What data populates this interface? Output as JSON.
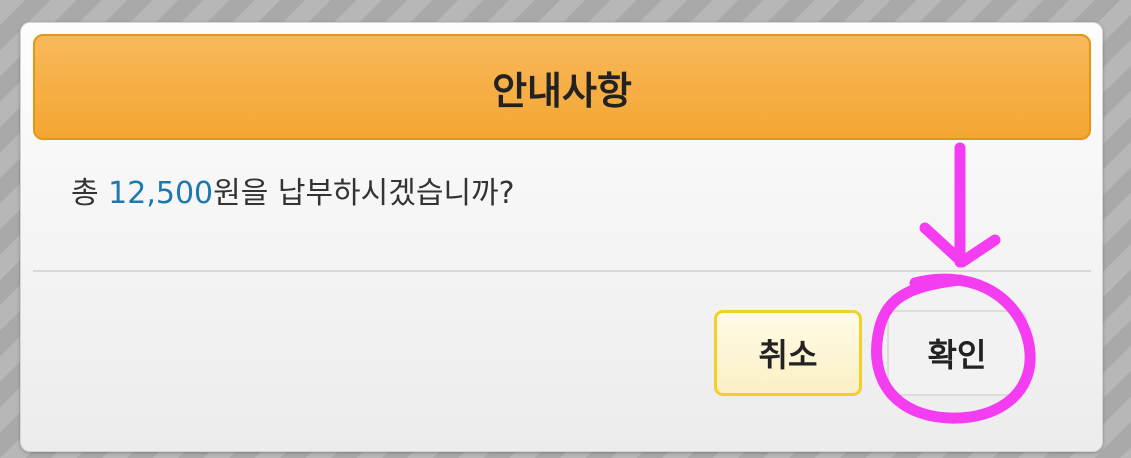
{
  "dialog": {
    "title": "안내사항",
    "message": {
      "prefix": "총 ",
      "amount": "12,500",
      "suffix": "원을 납부하시겠습니까?"
    },
    "buttons": {
      "cancel_label": "취소",
      "confirm_label": "확인"
    }
  },
  "colors": {
    "header": "#f4a632",
    "amount": "#1f78ad",
    "cancel_border": "#f3cf2a",
    "annotation": "#f43cf0"
  }
}
